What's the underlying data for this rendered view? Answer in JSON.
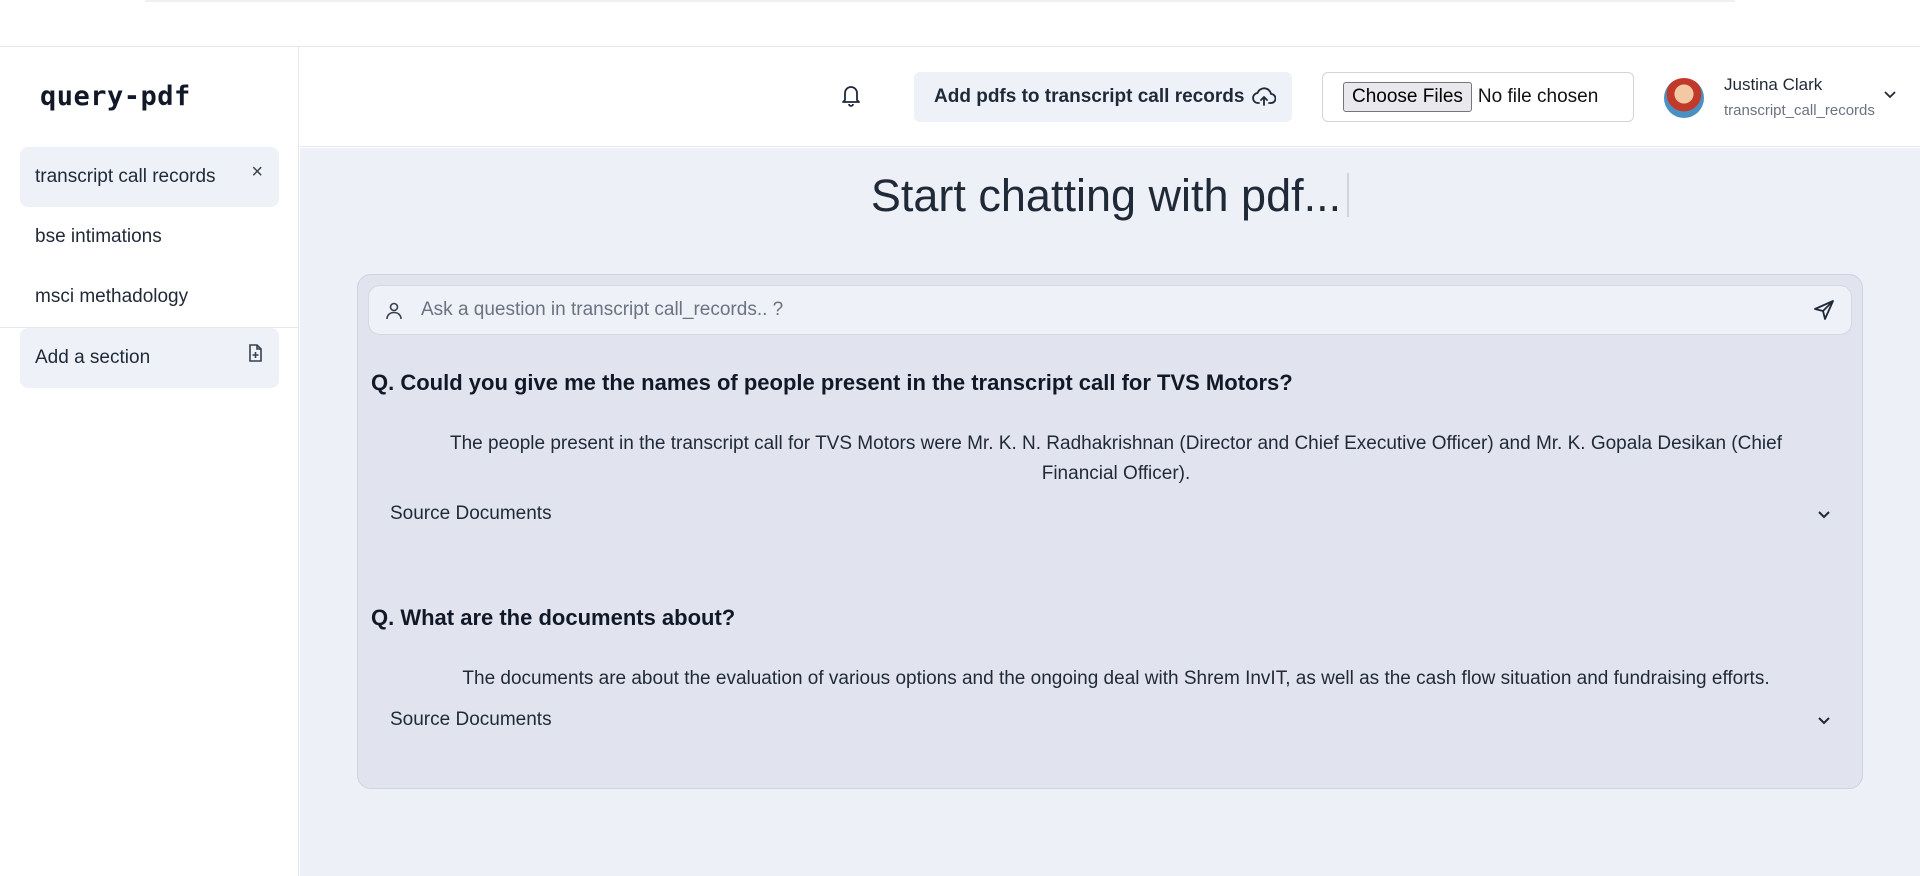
{
  "app": {
    "logo": "query-pdf"
  },
  "sidebar": {
    "items": [
      {
        "label": "transcript call records",
        "active": true
      },
      {
        "label": "bse intimations",
        "active": false
      },
      {
        "label": "msci methadology",
        "active": false
      }
    ],
    "add_section_label": "Add a section"
  },
  "header": {
    "add_pdf_label": "Add pdfs to transcript call records",
    "file_input": {
      "button_label": "Choose Files",
      "status": "No file chosen"
    },
    "user": {
      "name": "Justina Clark",
      "context": "transcript_call_records"
    }
  },
  "main": {
    "title": "Start chatting with pdf...",
    "ask_placeholder": "Ask a question in transcript call_records.. ?",
    "qa": [
      {
        "question": "Q. Could you give me the names of people present in the transcript call for TVS Motors?",
        "answer": "The people present in the transcript call for TVS Motors were Mr. K. N. Radhakrishnan (Director and Chief Executive Officer) and Mr. K. Gopala Desikan (Chief Financial Officer).",
        "source_label": "Source Documents"
      },
      {
        "question": "Q. What are the documents about?",
        "answer": "The documents are about the evaluation of various options and the ongoing deal with Shrem InvIT, as well as the cash flow situation and fundraising efforts.",
        "source_label": "Source Documents"
      }
    ]
  }
}
